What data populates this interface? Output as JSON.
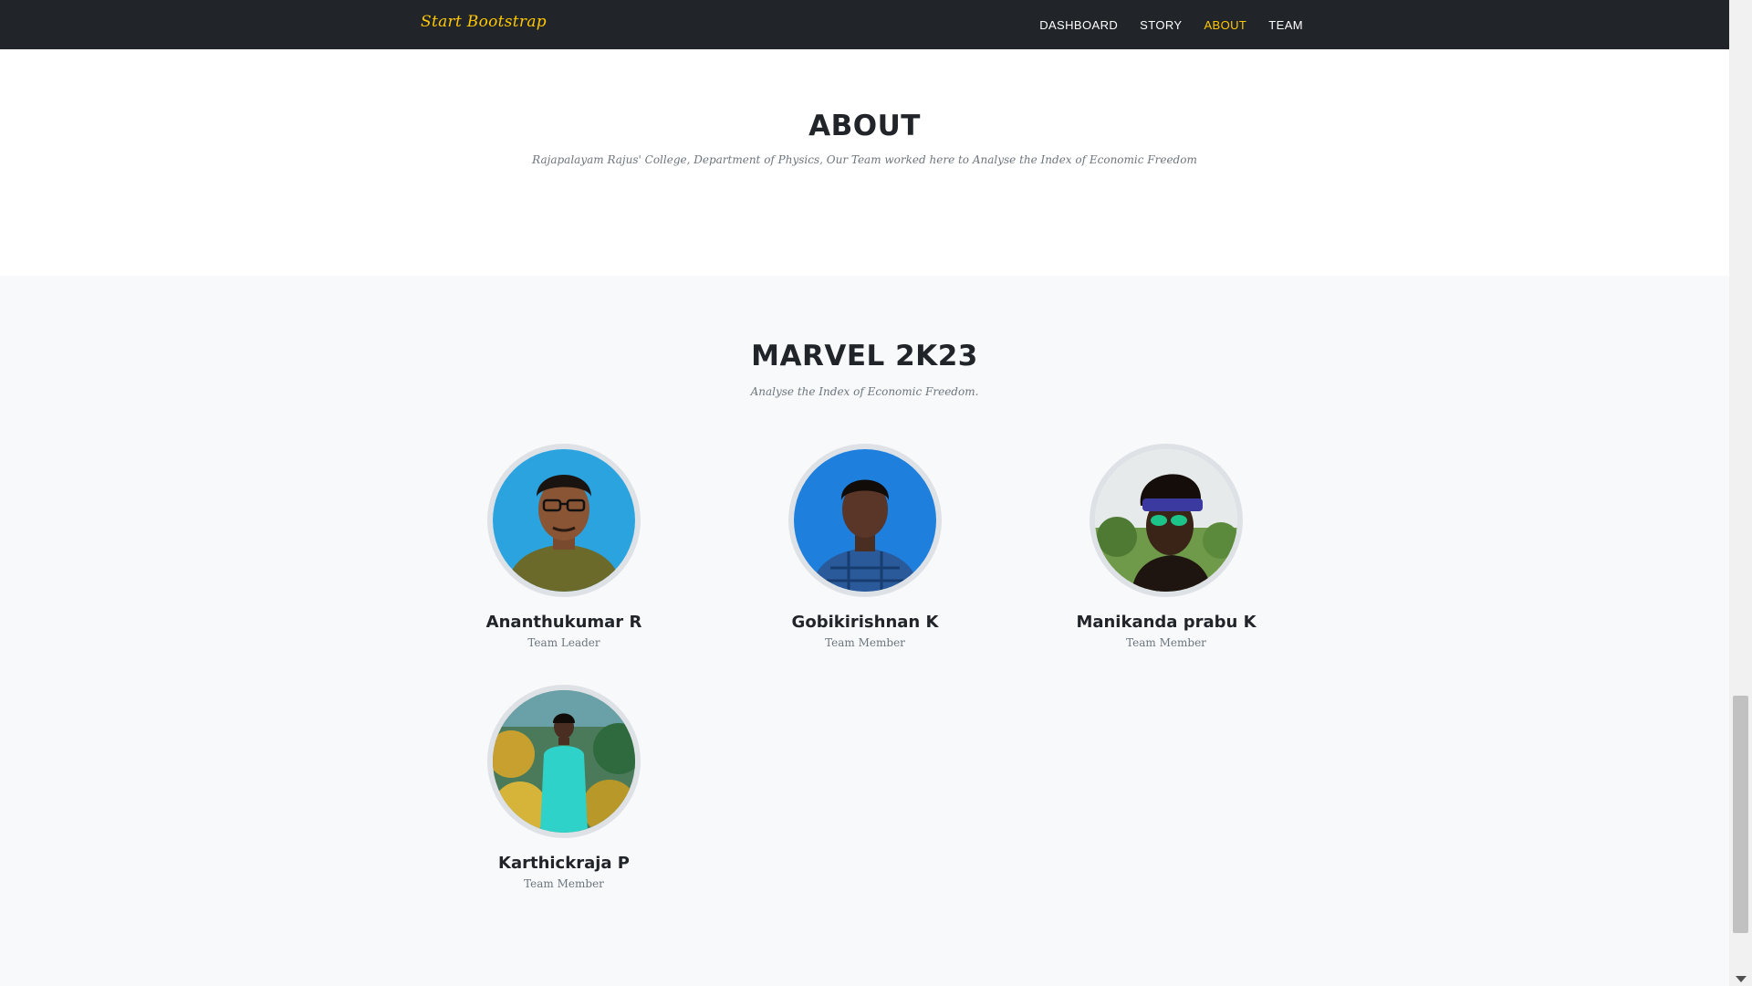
{
  "navbar": {
    "brand": "Start Bootstrap",
    "links": [
      {
        "label": "DASHBOARD",
        "active": false
      },
      {
        "label": "STORY",
        "active": false
      },
      {
        "label": "ABOUT",
        "active": true
      },
      {
        "label": "TEAM",
        "active": false
      }
    ]
  },
  "about": {
    "heading": "ABOUT",
    "subheading": "Rajapalayam Rajus' College, Department of Physics, Our Team worked here to Analyse the Index of Economic Freedom"
  },
  "team": {
    "heading": "MARVEL 2K23",
    "subheading": "Analyse the Index of Economic Freedom.",
    "members": [
      {
        "name": "Ananthukumar R",
        "role": "Team Leader",
        "photo": "person-photo-blue-background"
      },
      {
        "name": "Gobikirishnan K",
        "role": "Team Member",
        "photo": "person-photo-blue-background"
      },
      {
        "name": "Manikanda prabu K",
        "role": "Team Member",
        "photo": "person-photo-outdoor-sunglasses"
      },
      {
        "name": "Karthickraja P",
        "role": "Team Member",
        "photo": "person-photo-garden"
      }
    ]
  },
  "colors": {
    "navbar_bg": "#212529",
    "accent": "#ffc800",
    "heading": "#212529",
    "muted": "#6c757d",
    "section_bg": "#f8f9fa"
  }
}
